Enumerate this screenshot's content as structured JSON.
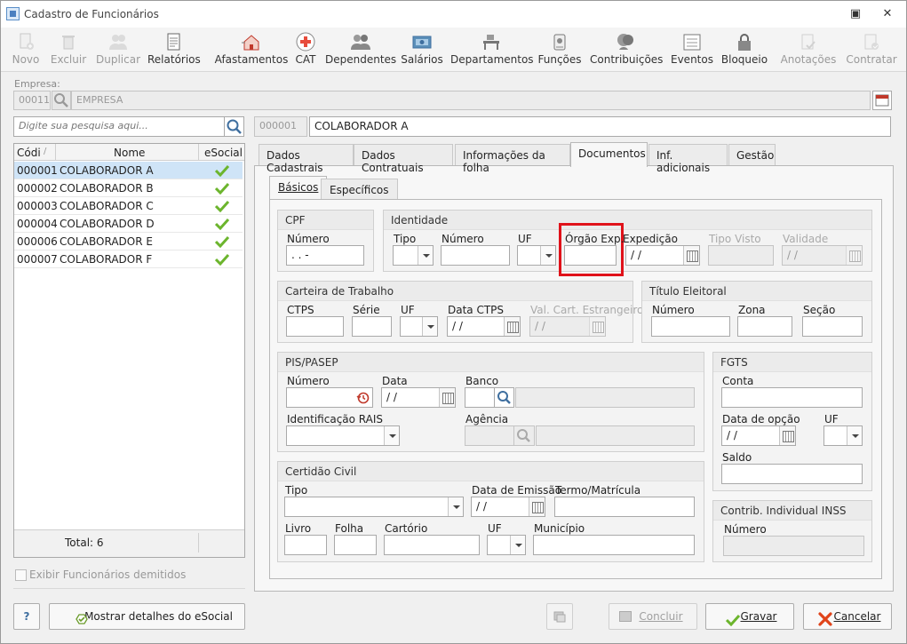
{
  "window": {
    "title": "Cadastro de Funcionários"
  },
  "toolbar": [
    {
      "label": "Novo",
      "icon": "new-doc-icon",
      "enabled": false
    },
    {
      "label": "Excluir",
      "icon": "trash-icon",
      "enabled": false
    },
    {
      "label": "Duplicar",
      "icon": "users-icon",
      "enabled": false
    },
    {
      "label": "Relatórios",
      "icon": "report-icon",
      "enabled": true
    },
    {
      "label": "Afastamentos",
      "icon": "house-icon",
      "enabled": true
    },
    {
      "label": "CAT",
      "icon": "medical-cross-icon",
      "enabled": true
    },
    {
      "label": "Dependentes",
      "icon": "people-icon",
      "enabled": true
    },
    {
      "label": "Salários",
      "icon": "money-icon",
      "enabled": true
    },
    {
      "label": "Departamentos",
      "icon": "desk-icon",
      "enabled": true
    },
    {
      "label": "Funções",
      "icon": "badge-icon",
      "enabled": true
    },
    {
      "label": "Contribuições",
      "icon": "heads-icon",
      "enabled": true
    },
    {
      "label": "Eventos",
      "icon": "list-icon",
      "enabled": true
    },
    {
      "label": "Bloqueio",
      "icon": "lock-icon",
      "enabled": true
    },
    {
      "label": "Anotações",
      "icon": "note-check-icon",
      "enabled": false
    },
    {
      "label": "Contratar",
      "icon": "contract-icon",
      "enabled": false
    }
  ],
  "empresa": {
    "label": "Empresa:",
    "code": "00011",
    "name": "EMPRESA"
  },
  "search": {
    "placeholder": "Digite sua pesquisa aqui..."
  },
  "selected": {
    "code": "000001",
    "name": "COLABORADOR A"
  },
  "grid": {
    "headers": {
      "code": "Códi",
      "name": "Nome",
      "esocial": "eSocial"
    },
    "rows": [
      {
        "code": "000001",
        "name": "COLABORADOR A"
      },
      {
        "code": "000002",
        "name": "COLABORADOR B"
      },
      {
        "code": "000003",
        "name": "COLABORADOR C"
      },
      {
        "code": "000004",
        "name": "COLABORADOR D"
      },
      {
        "code": "000006",
        "name": "COLABORADOR E"
      },
      {
        "code": "000007",
        "name": "COLABORADOR F"
      }
    ],
    "total": "Total: 6"
  },
  "show_dismissed": "Exibir Funcionários demitidos",
  "tabs": [
    "Dados Cadastrais",
    "Dados Contratuais",
    "Informações da folha",
    "Documentos",
    "Inf. adicionais",
    "Gestão"
  ],
  "subtabs": [
    "Básicos",
    "Específicos"
  ],
  "cpf": {
    "title": "CPF",
    "numero_label": "Número",
    "numero_value": " .   .   -"
  },
  "identidade": {
    "title": "Identidade",
    "tipo": "Tipo",
    "numero": "Número",
    "uf": "UF",
    "orgao": "Órgão Exp.",
    "expedicao": "Expedição",
    "expedicao_value": " / /",
    "tipo_visto": "Tipo Visto",
    "validade": "Validade",
    "validade_value": " / /"
  },
  "ctps": {
    "title": "Carteira de Trabalho",
    "ctps": "CTPS",
    "serie": "Série",
    "uf": "UF",
    "data": "Data CTPS",
    "data_value": " / /",
    "val": "Val. Cart. Estrangeiro",
    "val_value": " / /"
  },
  "titulo": {
    "title": "Título Eleitoral",
    "numero": "Número",
    "zona": "Zona",
    "secao": "Seção"
  },
  "pis": {
    "title": "PIS/PASEP",
    "numero": "Número",
    "data": "Data",
    "data_value": " / /",
    "banco": "Banco",
    "rais": "Identificação RAIS",
    "agencia": "Agência"
  },
  "fgts": {
    "title": "FGTS",
    "conta": "Conta",
    "data_opcao": "Data de opção",
    "data_opcao_value": " / /",
    "uf": "UF",
    "saldo": "Saldo"
  },
  "certidao": {
    "title": "Certidão Civil",
    "tipo": "Tipo",
    "data_emissao": "Data de Emissão",
    "data_emissao_value": " / /",
    "termo": "Termo/Matrícula",
    "livro": "Livro",
    "folha": "Folha",
    "cartorio": "Cartório",
    "uf": "UF",
    "municipio": "Município"
  },
  "inss": {
    "title": "Contrib. Individual INSS",
    "numero": "Número"
  },
  "footer": {
    "help": "?",
    "esocial_details": "Mostrar detalhes do eSocial",
    "concluir": "Concluir",
    "gravar": "Gravar",
    "cancelar": "Cancelar"
  },
  "colors": {
    "highlight": "#e0121a",
    "selected_row": "#cfe4f7",
    "check": "#6cb52d"
  }
}
